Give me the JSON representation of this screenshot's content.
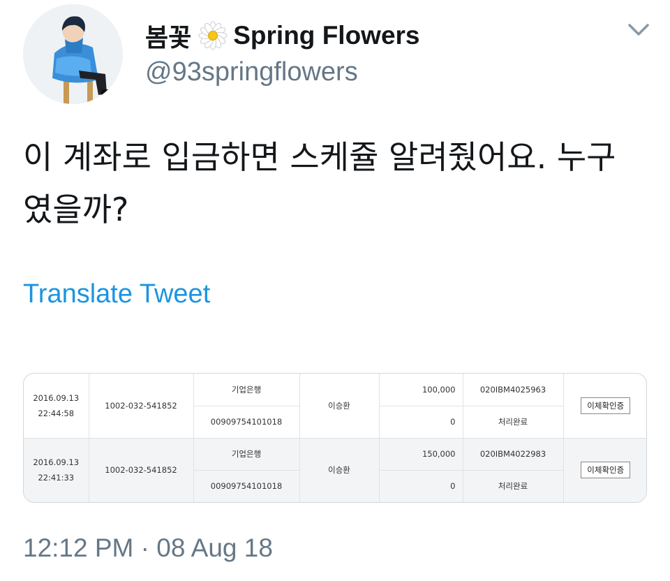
{
  "tweet": {
    "author": {
      "name_ko": "봄꽃",
      "flower_icon": "daisy-icon",
      "name_en": "Spring Flowers",
      "handle": "@93springflowers"
    },
    "text": "이 계좌로 입금하면 스케쥴 알려줬어요. 누구였을까?",
    "translate_label": "Translate Tweet",
    "timestamp": "12:12 PM · 08 Aug 18",
    "more_icon": "chevron-down-icon"
  },
  "transactions": [
    {
      "date": "2016.09.13",
      "time": "22:44:58",
      "account": "1002-032-541852",
      "bank": "기업은행",
      "recipient_account": "00909754101018",
      "name": "이승환",
      "amount": "100,000",
      "fee": "0",
      "transaction_id": "020IBM4025963",
      "status": "처리완료",
      "button_label": "이체확인증"
    },
    {
      "date": "2016.09.13",
      "time": "22:41:33",
      "account": "1002-032-541852",
      "bank": "기업은행",
      "recipient_account": "00909754101018",
      "name": "이승환",
      "amount": "150,000",
      "fee": "0",
      "transaction_id": "020IBM4022983",
      "status": "처리완료",
      "button_label": "이체확인증"
    }
  ],
  "colors": {
    "text": "#14171a",
    "secondary": "#657786",
    "link": "#1b95e0"
  }
}
